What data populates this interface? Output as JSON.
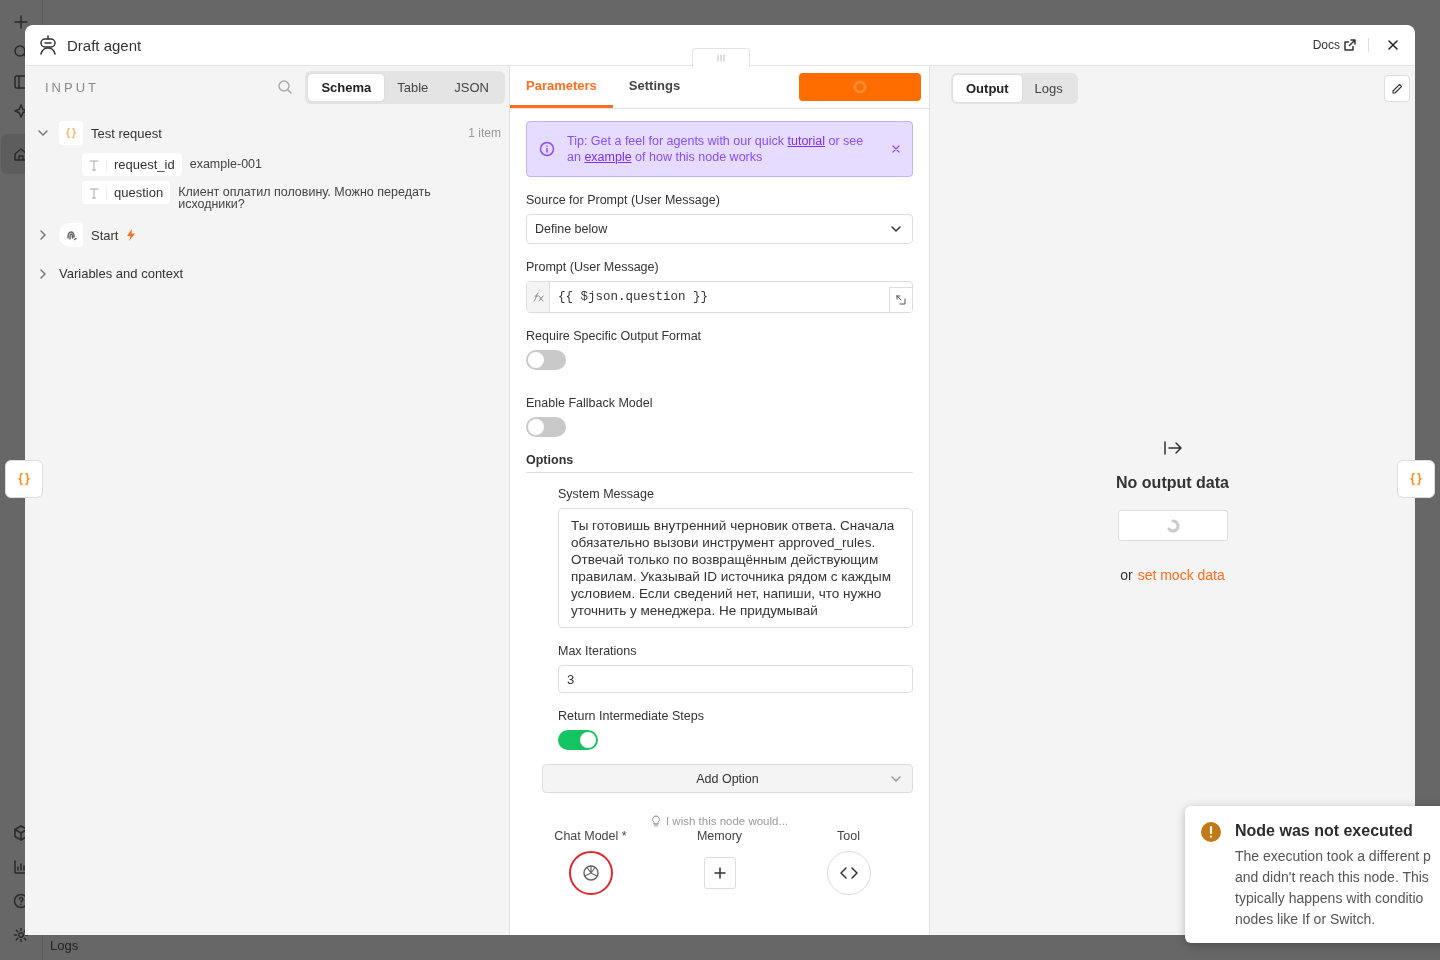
{
  "app_rail": {
    "bottom_tab": "Logs"
  },
  "window": {
    "title": "Draft agent",
    "docs_link": "Docs"
  },
  "input_panel": {
    "heading": "INPUT",
    "view_tabs": [
      {
        "label": "Schema",
        "selected": true
      },
      {
        "label": "Table",
        "selected": false
      },
      {
        "label": "JSON",
        "selected": false
      }
    ],
    "tree": [
      {
        "kind": "object",
        "label": "Test request",
        "count": "1 item",
        "expanded": true,
        "fields": [
          {
            "key": "request_id",
            "value": "example-001"
          },
          {
            "key": "question",
            "value": "Клиент оплатил половину. Можно передать исходники?"
          }
        ]
      },
      {
        "kind": "trigger",
        "label": "Start",
        "expanded": false
      }
    ],
    "variables": {
      "label": "Variables and context",
      "expanded": false
    }
  },
  "parameters_panel": {
    "tabs": [
      {
        "label": "Parameters",
        "selected": true
      },
      {
        "label": "Settings",
        "selected": false
      }
    ],
    "tip": {
      "before": "Tip: Get a feel for agents with our quick ",
      "link_1": "tutorial",
      "middle": " or see an ",
      "link_2": "example",
      "after": " of how this node works"
    },
    "fields": [
      {
        "kind": "select",
        "label": "Source for Prompt (User Message)",
        "value": "Define below"
      },
      {
        "kind": "expression",
        "label": "Prompt (User Message)",
        "value": "{{ $json.question }}"
      },
      {
        "kind": "toggle",
        "label": "Require Specific Output Format",
        "on": false
      },
      {
        "kind": "toggle",
        "label": "Enable Fallback Model",
        "on": false
      }
    ],
    "options": {
      "heading": "Options",
      "fields": [
        {
          "kind": "textarea",
          "label": "System Message",
          "value": "Ты готовишь внутренний черновик ответа. Сначала обязательно вызови инструмент approved_rules. Отвечай только по возвращённым действующим правилам. Указывай ID источника рядом с каждым условием. Если сведений нет, напиши, что нужно уточнить у менеджера. Не придумывай"
        },
        {
          "kind": "number",
          "label": "Max Iterations",
          "value": "3"
        },
        {
          "kind": "toggle",
          "label": "Return Intermediate Steps",
          "on": true
        }
      ],
      "add_button": "Add Option"
    },
    "feedback_hint": "I wish this node would...",
    "connectors": [
      {
        "kind": "model",
        "label": "Chat Model *"
      },
      {
        "kind": "add",
        "label": "Memory"
      },
      {
        "kind": "tool",
        "label": "Tool"
      }
    ]
  },
  "output_panel": {
    "tabs": [
      {
        "label": "Output",
        "selected": true
      },
      {
        "label": "Logs",
        "selected": false
      }
    ],
    "empty_title": "No output data",
    "mock_prefix": "or",
    "mock_link": "set mock data"
  },
  "toast": {
    "title": "Node was not executed",
    "message_lines": [
      "The execution took a different p",
      "and didn't reach this node. This",
      "typically happens with conditio",
      "nodes like If or Switch."
    ]
  }
}
